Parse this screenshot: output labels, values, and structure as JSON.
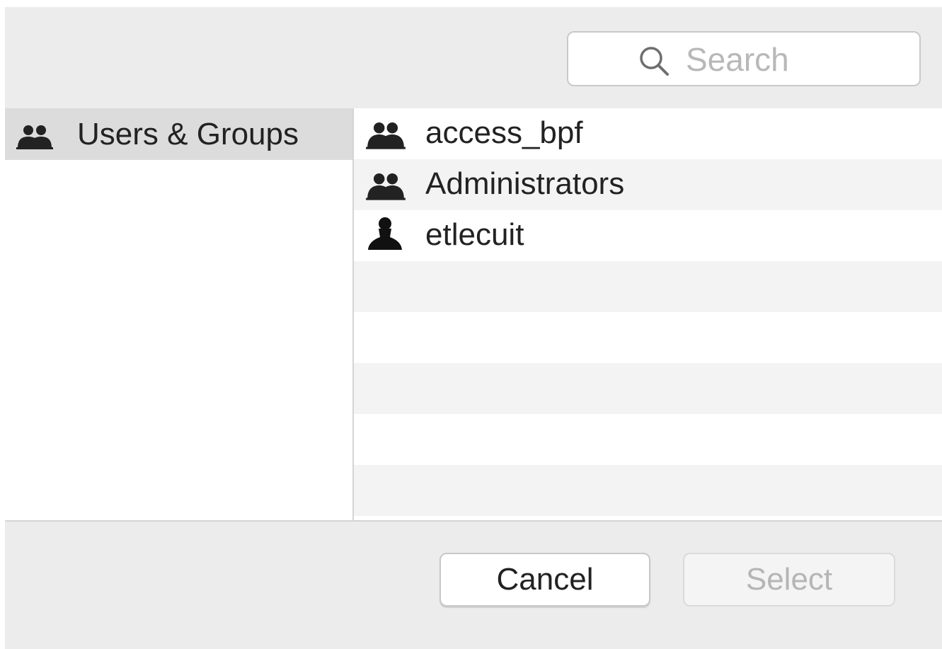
{
  "search": {
    "placeholder": "Search",
    "value": ""
  },
  "sidebar": {
    "items": [
      {
        "label": "Users & Groups",
        "icon": "group-icon",
        "selected": true
      }
    ]
  },
  "list": {
    "items": [
      {
        "label": "access_bpf",
        "icon": "group-icon"
      },
      {
        "label": "Administrators",
        "icon": "group-icon"
      },
      {
        "label": "etlecuit",
        "icon": "user-icon"
      }
    ]
  },
  "buttons": {
    "cancel_label": "Cancel",
    "select_label": "Select",
    "select_enabled": false
  },
  "colors": {
    "chrome": "#ececec",
    "selection": "#dcdcdc",
    "stripe": "#f3f3f3",
    "disabled_text": "#b5b5b5"
  }
}
